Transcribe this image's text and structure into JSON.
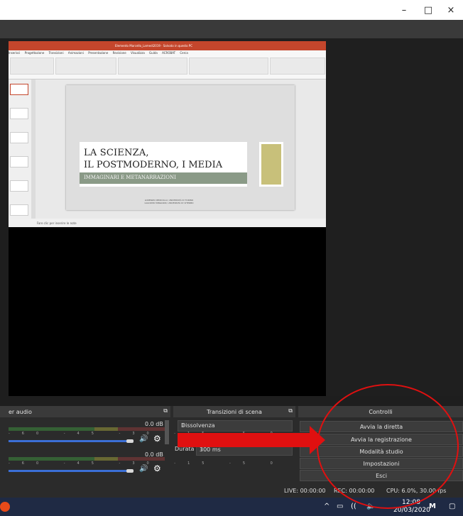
{
  "window": {
    "minimize": "–",
    "maximize": "□",
    "close": "×"
  },
  "ppt": {
    "title_text": "Elemento Marcello_Lamedi2019 · Salvato in questo PC",
    "menu": [
      "Inserisci",
      "Progettazione",
      "Transizioni",
      "Animazioni",
      "Presentazione",
      "Revisione",
      "Visualizza",
      "Guida",
      "ACROBAT",
      "Cerca"
    ],
    "slide_title_line1": "LA SCIENZA,",
    "slide_title_line2": "IL POSTMODERNO, I MEDIA",
    "slide_subtitle": "IMMAGINARI E METANARRAZIONI",
    "authors_line1": "LORENZO DENICOLAI, UNIVERSITÀ DI TORINO",
    "authors_line2": "GIACOMO MINGOZZI, UNIVERSITÀ DI VITERBO",
    "notes_placeholder": "Fare clic per inserire le note"
  },
  "docks": {
    "mixer_title": "er audio",
    "transitions_title": "Transizioni di scena",
    "controls_title": "Controlli"
  },
  "mixer": {
    "track1_db": "0.0 dB",
    "track2_db": "0.0 dB",
    "ticks": "-60 -45 -30 -15 -5 0"
  },
  "transitions": {
    "selected": "Dissolvenza",
    "duration_label": "Durata",
    "duration_value": "300 ms"
  },
  "controls": {
    "start_stream": "Avvia la diretta",
    "start_recording": "Avvia la registrazione",
    "studio_mode": "Modalità studio",
    "settings": "Impostazioni",
    "exit": "Esci"
  },
  "status": {
    "live": "LIVE: 00:00:00",
    "rec": "REC: 00:00:00",
    "cpu": "CPU: 6.0%, 30.00 fps"
  },
  "taskbar": {
    "time": "12:08",
    "date": "20/03/2020"
  },
  "colors": {
    "annotation_red": "#e01010",
    "obs_dark": "#2b2b2b",
    "ppt_brand": "#c4462c"
  }
}
